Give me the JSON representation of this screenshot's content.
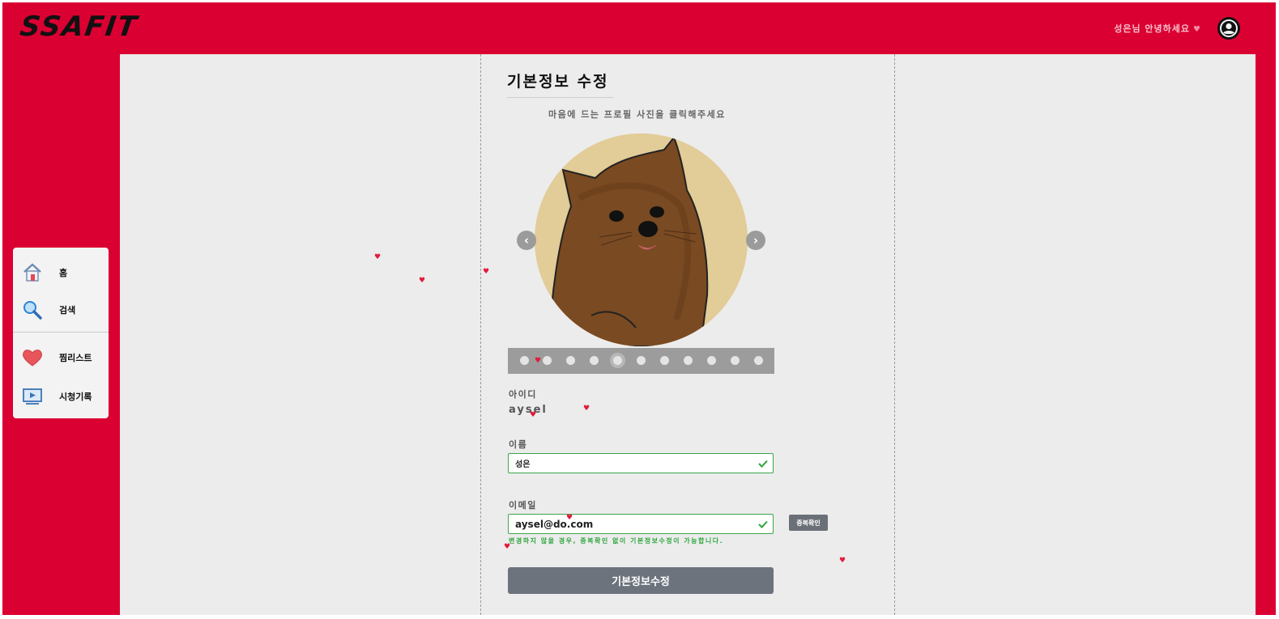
{
  "app": {
    "logo": "SSAFIT"
  },
  "header": {
    "greeting": "성은님 안녕하세요",
    "greeting_heart": "♥"
  },
  "sidebar": {
    "items": [
      {
        "label": "홈",
        "icon": "home-icon"
      },
      {
        "label": "검색",
        "icon": "search-icon"
      },
      {
        "label": "찜리스트",
        "icon": "heart-icon"
      },
      {
        "label": "시청기록",
        "icon": "play-screen-icon"
      }
    ]
  },
  "form": {
    "title": "기본정보 수정",
    "subtitle": "마음에 드는 프로필 사진을 클릭해주세요",
    "carousel": {
      "prev": "‹",
      "next": "›",
      "dot_count": 11,
      "active_index": 4
    },
    "id_label": "아이디",
    "id_value": "aysel",
    "name_label": "이름",
    "name_value": "성은",
    "email_label": "이메일",
    "email_value": "aysel@do.com",
    "dup_check_label": "중복확인",
    "email_hint": "변경하지 않을 경우, 중복확인 없이 기본정보수정이 가능합니다.",
    "submit_label": "기본정보수정"
  },
  "colors": {
    "brand_red": "#db0032",
    "panel_bg": "#ececec",
    "valid_green": "#3aa84a",
    "button_gray": "#6c737d"
  },
  "decor": {
    "heart": "♥"
  }
}
